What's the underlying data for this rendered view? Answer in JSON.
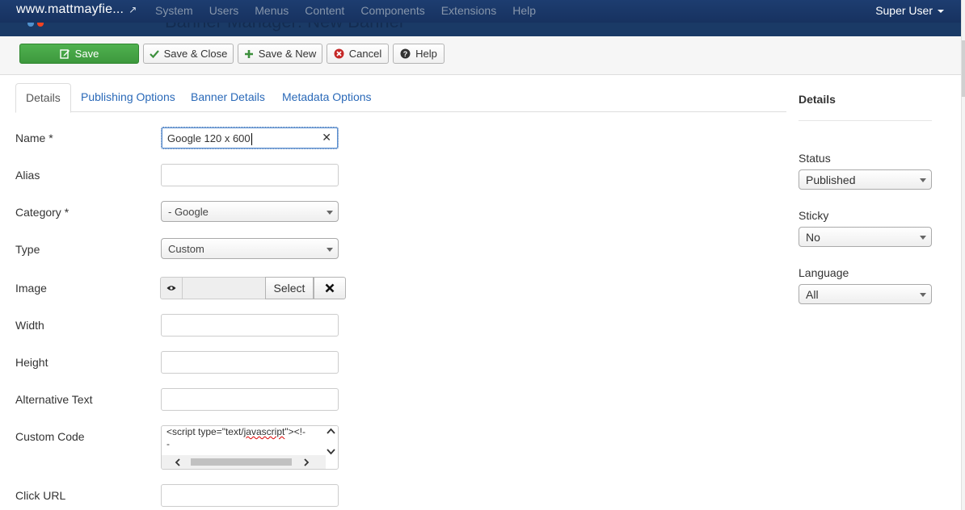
{
  "navbar": {
    "site": "www.mattmayfie...",
    "menu": [
      "System",
      "Users",
      "Menus",
      "Content",
      "Components",
      "Extensions",
      "Help"
    ],
    "user": "Super User"
  },
  "header": {
    "title": "Banner Manager: New Banner"
  },
  "toolbar": {
    "save": "Save",
    "save_close": "Save & Close",
    "save_new": "Save & New",
    "cancel": "Cancel",
    "help": "Help"
  },
  "tabs": [
    "Details",
    "Publishing Options",
    "Banner Details",
    "Metadata Options"
  ],
  "form": {
    "name_label": "Name *",
    "name_value": "Google 120 x 600",
    "alias_label": "Alias",
    "alias_value": "",
    "category_label": "Category *",
    "category_value": "- Google",
    "type_label": "Type",
    "type_value": "Custom",
    "image_label": "Image",
    "image_select": "Select",
    "width_label": "Width",
    "height_label": "Height",
    "alt_label": "Alternative Text",
    "custom_code_label": "Custom Code",
    "custom_code_line1a": "<script type=\"text/",
    "custom_code_line1b": "javascript",
    "custom_code_line1c": "\"><!-",
    "custom_code_line2": "-",
    "click_url_label": "Click URL"
  },
  "sidebar": {
    "title": "Details",
    "status_label": "Status",
    "status_value": "Published",
    "sticky_label": "Sticky",
    "sticky_value": "No",
    "language_label": "Language",
    "language_value": "All"
  },
  "colors": {
    "navbar": "#1a3867",
    "save_green": "#46a546",
    "link_blue": "#2a69b8"
  }
}
